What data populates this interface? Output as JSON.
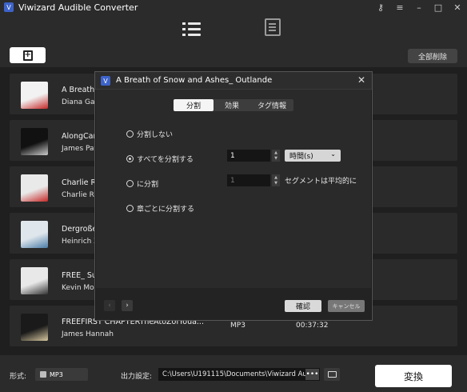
{
  "app": {
    "title": "Viwizard Audible Converter",
    "logo_icon": "app-logo-icon"
  },
  "window_controls": [
    {
      "name": "key-icon",
      "glyph": "⚷"
    },
    {
      "name": "menu-icon",
      "glyph": "≡"
    },
    {
      "name": "minimize-icon",
      "glyph": "–"
    },
    {
      "name": "maximize-icon",
      "glyph": "□"
    },
    {
      "name": "close-icon",
      "glyph": "✕"
    }
  ],
  "toolbar": {
    "nav": [
      {
        "name": "list-icon",
        "active": true
      },
      {
        "name": "history-icon",
        "active": false
      }
    ],
    "clear_all_label": "全部削除"
  },
  "books": [
    {
      "title": "A Breath",
      "author": "Diana Gab",
      "format": "",
      "duration": "",
      "thumb_color": "#f2f2f2",
      "thumb_accent": "#c62828"
    },
    {
      "title": "AlongCar",
      "author": "James Pat",
      "format": "",
      "duration": "",
      "thumb_color": "#111111",
      "thumb_accent": "#cccccc"
    },
    {
      "title": "Charlie R",
      "author": "Charlie Ro",
      "format": "",
      "duration": "",
      "thumb_color": "#e9e9e9",
      "thumb_accent": "#c62828"
    },
    {
      "title": "Dergroße",
      "author": "Heinrich Z",
      "format": "",
      "duration": "",
      "thumb_color": "#dfe6ec",
      "thumb_accent": "#4a7ca8"
    },
    {
      "title": "FREE_ Su",
      "author": "Kevin Mor",
      "format": "",
      "duration": "",
      "thumb_color": "#e8e8e8",
      "thumb_accent": "#333333"
    },
    {
      "title": "FREEFIRST CHAPTERTheAtoZofYoua...",
      "author": "James Hannah",
      "format": "MP3",
      "duration": "00:37:32",
      "thumb_color": "#1a1a1a",
      "thumb_accent": "#d8c8a0"
    }
  ],
  "bottom": {
    "format_label": "形式:",
    "format_value": "MP3",
    "output_label": "出力設定:",
    "output_path": "C:\\Users\\U191115\\Documents\\Viwizard Au",
    "more_label": "•••",
    "convert_label": "変換"
  },
  "dialog": {
    "title": "A Breath of Snow and Ashes_ Outlande",
    "tabs": [
      {
        "label": "分割",
        "active": true
      },
      {
        "label": "効果",
        "active": false
      },
      {
        "label": "タグ情報",
        "active": false
      }
    ],
    "options": [
      {
        "label": "分割しない",
        "selected": false
      },
      {
        "label": "すべてを分割する",
        "selected": true
      },
      {
        "label": "に分割",
        "selected": false
      },
      {
        "label": "章ごとに分割する",
        "selected": false
      }
    ],
    "split_every_value": "1",
    "unit_value": "時間(s)",
    "split_into_value": "1",
    "segment_note": "セグメントは平均的に",
    "ok_label": "確認",
    "cancel_label": "キャンセル",
    "prev_glyph": "‹",
    "next_glyph": "›"
  }
}
